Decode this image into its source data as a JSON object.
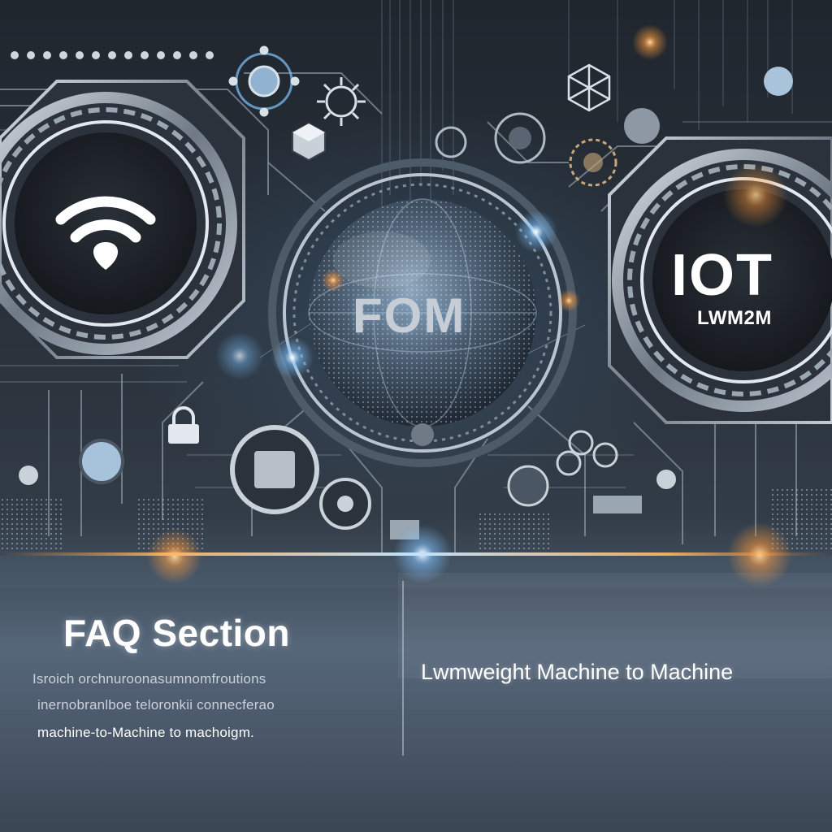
{
  "globe": {
    "label": "FOM"
  },
  "badge": {
    "title": "IOT",
    "subtitle": "LWM2M"
  },
  "faq": {
    "title": "FAQ Section",
    "lines": [
      "Isroich orchnuroonasumnomfroutions",
      "inernobranlboe teloronkii connecferao",
      "machine-to-Machine  to machoigm."
    ]
  },
  "tagline": "Lwmweight Machine to Machine",
  "icons": {
    "left_dial": "wifi-icon",
    "center": "globe-icon",
    "right_dial": "iot-badge-icon",
    "small": [
      "lock-icon",
      "gear-icon",
      "cube-icon",
      "chip-icon",
      "network-icon"
    ]
  },
  "colors": {
    "glow_orange": "#ff9a3c",
    "glow_blue": "#7fc4ff",
    "dial_dark": "#1c2128",
    "metal": "#9aa6b2",
    "circuit": "#8e99a6"
  }
}
